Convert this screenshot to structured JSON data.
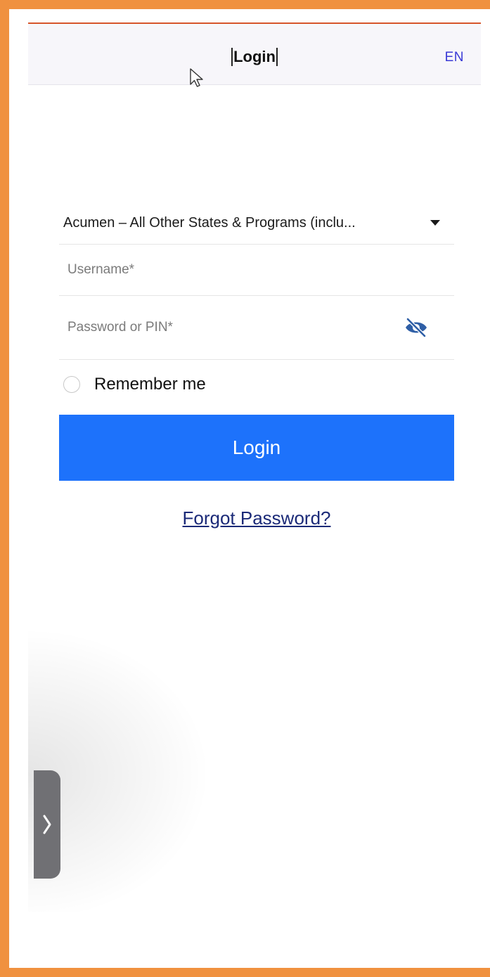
{
  "header": {
    "title": "Login",
    "language": "EN"
  },
  "form": {
    "program": "Acumen – All Other States & Programs (inclu...",
    "username_placeholder": "Username*",
    "password_placeholder": "Password or PIN*",
    "remember_label": "Remember me",
    "login_label": "Login",
    "forgot_label": "Forgot Password?"
  },
  "colors": {
    "accent_blue": "#1d72fb",
    "frame_orange": "#f0913f",
    "language_blue": "#3a3ad6",
    "eye_icon": "#2f5fa6"
  },
  "icons": {
    "visibility_toggle": "eye-slash-icon",
    "select_caret": "caret-down-icon",
    "side_tab": "chevron-right-icon"
  }
}
